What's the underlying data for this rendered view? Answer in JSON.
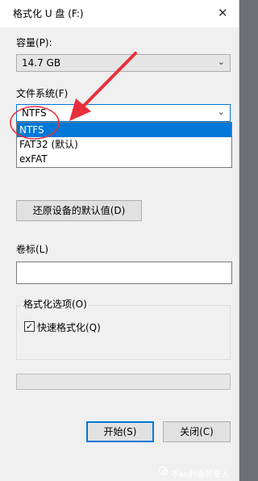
{
  "window": {
    "title": "格式化 U 盘 (F:)"
  },
  "capacity": {
    "label": "容量(P):",
    "value": "14.7 GB"
  },
  "filesystem": {
    "label": "文件系统(F)",
    "value": "NTFS",
    "options": [
      "NTFS",
      "FAT32 (默认)",
      "exFAT"
    ],
    "selected_index": 0
  },
  "restore_button": "还原设备的默认值(D)",
  "volume": {
    "label": "卷标(L)",
    "value": ""
  },
  "format_options": {
    "label": "格式化选项(O)",
    "quick_format": {
      "label": "快速格式化(Q)",
      "checked": true
    }
  },
  "progress": {
    "value": 0
  },
  "buttons": {
    "start": "开始(S)",
    "close": "关闭(C)"
  },
  "watermark": "不an利会死星人",
  "colors": {
    "accent": "#0078d7",
    "annotation": "#e8303a"
  },
  "icons": {
    "close": "close-icon",
    "chevron": "chevron-down-icon",
    "check": "checkmark-icon"
  }
}
